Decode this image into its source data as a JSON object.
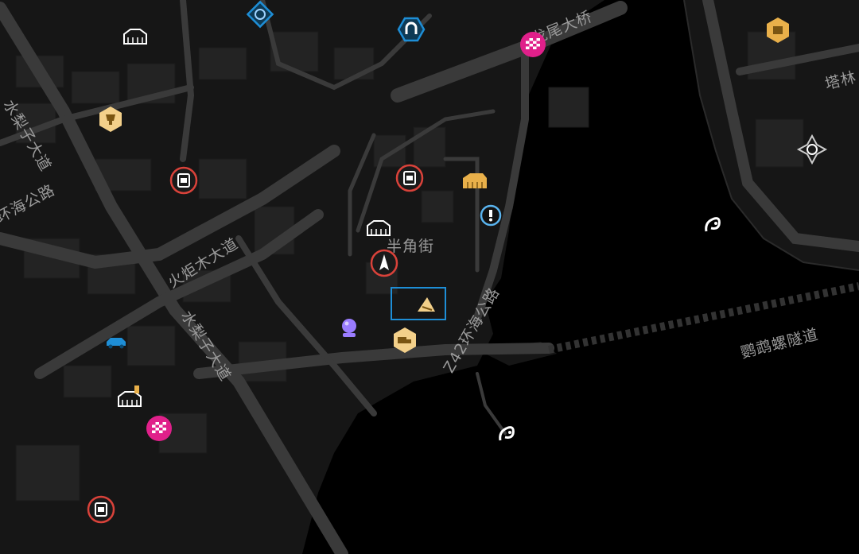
{
  "map": {
    "labels": {
      "shui_li_zi_top": "水梨子大道",
      "shui_li_zi_mid": "水梨子大道",
      "huo_ju_mu": "火炬木大道",
      "huan_hai_left": "环海公路",
      "huan_hai_z42": "Z42环海公路",
      "ban_jiao_jie": "半角街",
      "ying_wu_tunnel": "鹦鹉螺隧道",
      "dragon_bridge": "龙尾大桥",
      "ta_jie": "塔林"
    },
    "colors": {
      "background": "#000000",
      "land": "#141414",
      "road": "#3a3a3a",
      "building": "#222222",
      "accent_blue": "#1e8ed6",
      "race_pink": "#e0208a",
      "gold": "#e9b04a",
      "red_ring": "#d9423a",
      "purple": "#9a7cff"
    },
    "icons": [
      "warehouse-icon",
      "diamond-emblem-icon",
      "magnet-icon",
      "race-flag-icon",
      "gold-hexagon-icon",
      "tower-icon",
      "gas-can-icon",
      "trophy-icon",
      "info-exclamation-icon",
      "factory-icon",
      "rocket-tower-icon",
      "purple-orb-icon",
      "car-icon",
      "truck-icon",
      "gear-emblem-icon",
      "fishing-icon"
    ]
  }
}
